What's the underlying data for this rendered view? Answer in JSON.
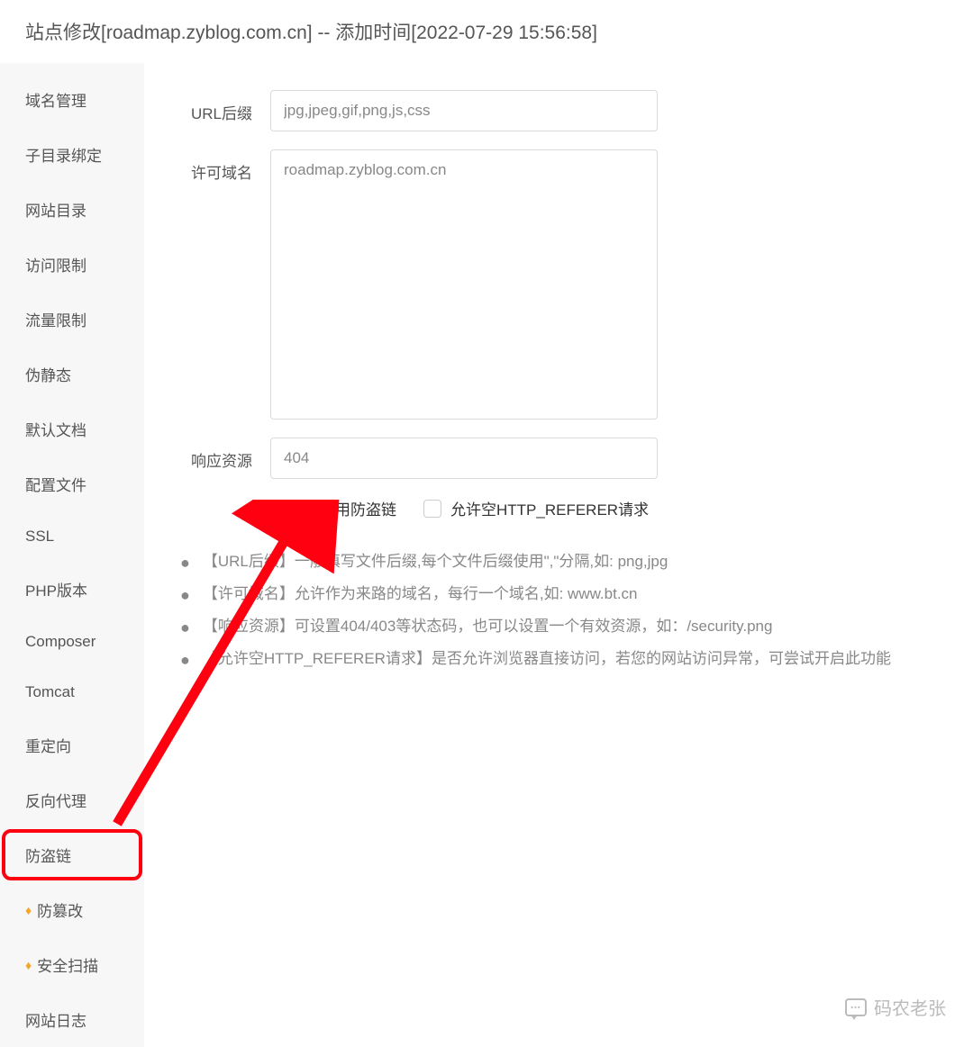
{
  "header": {
    "title": "站点修改[roadmap.zyblog.com.cn] -- 添加时间[2022-07-29 15:56:58]"
  },
  "sidebar": {
    "items": [
      {
        "label": "域名管理",
        "icon": null
      },
      {
        "label": "子目录绑定",
        "icon": null
      },
      {
        "label": "网站目录",
        "icon": null
      },
      {
        "label": "访问限制",
        "icon": null
      },
      {
        "label": "流量限制",
        "icon": null
      },
      {
        "label": "伪静态",
        "icon": null
      },
      {
        "label": "默认文档",
        "icon": null
      },
      {
        "label": "配置文件",
        "icon": null
      },
      {
        "label": "SSL",
        "icon": null
      },
      {
        "label": "PHP版本",
        "icon": null
      },
      {
        "label": "Composer",
        "icon": null
      },
      {
        "label": "Tomcat",
        "icon": null
      },
      {
        "label": "重定向",
        "icon": null
      },
      {
        "label": "反向代理",
        "icon": null
      },
      {
        "label": "防盗链",
        "icon": null,
        "highlight": true
      },
      {
        "label": "防篡改",
        "icon": "diamond"
      },
      {
        "label": "安全扫描",
        "icon": "diamond"
      },
      {
        "label": "网站日志",
        "icon": null
      }
    ]
  },
  "form": {
    "url_suffix_label": "URL后缀",
    "url_suffix_value": "jpg,jpeg,gif,png,js,css",
    "allow_domain_label": "许可域名",
    "allow_domain_value": "roadmap.zyblog.com.cn",
    "response_label": "响应资源",
    "response_value": "404",
    "enable_label": "启用防盗链",
    "enable_checked": true,
    "empty_referer_label": "允许空HTTP_REFERER请求",
    "empty_referer_checked": false
  },
  "tips": [
    "【URL后缀】一般填写文件后缀,每个文件后缀使用\",\"分隔,如: png,jpg",
    "【许可域名】允许作为来路的域名，每行一个域名,如: www.bt.cn",
    "【响应资源】可设置404/403等状态码，也可以设置一个有效资源，如：/security.png",
    "【允许空HTTP_REFERER请求】是否允许浏览器直接访问，若您的网站访问异常，可尝试开启此功能"
  ],
  "watermark": {
    "text": "码农老张"
  }
}
